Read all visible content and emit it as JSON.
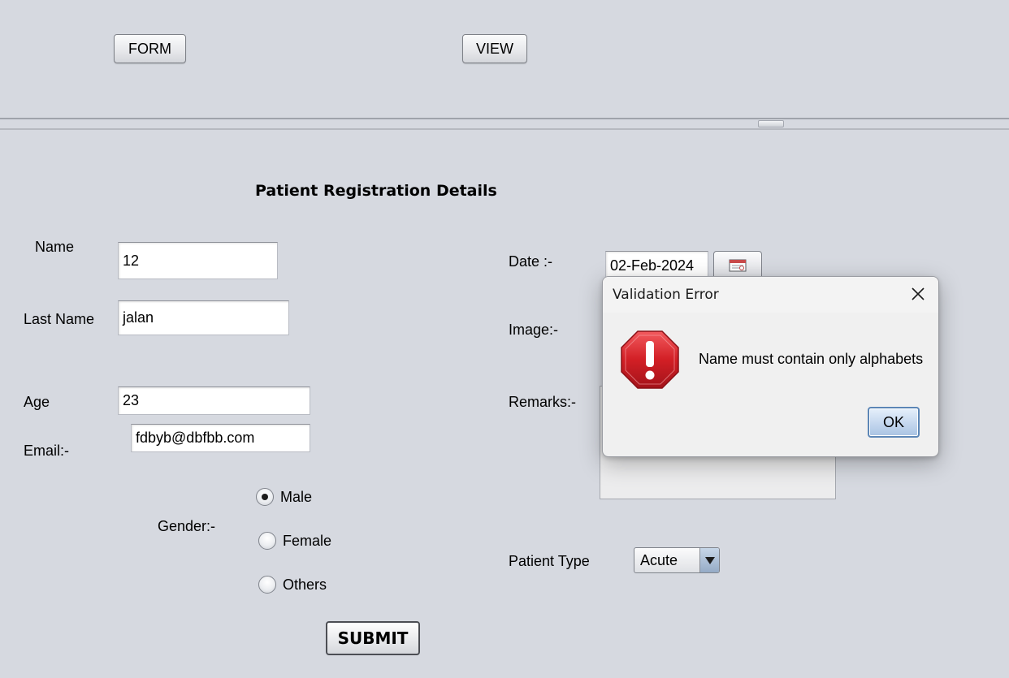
{
  "toolbar": {
    "form_label": "FORM",
    "view_label": "VIEW"
  },
  "form": {
    "title": "Patient Registration Details",
    "name_label": "Name",
    "name_value": "12",
    "last_name_label": "Last Name",
    "last_name_value": "jalan",
    "age_label": "Age",
    "age_value": "23",
    "email_label": "Email:-",
    "email_value": "fdbyb@dbfbb.com",
    "gender_label": "Gender:-",
    "gender_options": [
      "Male",
      "Female",
      "Others"
    ],
    "gender_selected": "Male",
    "date_label": "Date :-",
    "date_value": "02-Feb-2024",
    "image_label": "Image:-",
    "remarks_label": "Remarks:-",
    "patient_type_label": "Patient Type",
    "patient_type_value": "Acute",
    "submit_label": "SUBMIT"
  },
  "dialog": {
    "title": "Validation Error",
    "message": "Name must contain only alphabets",
    "ok_label": "OK",
    "icon": "error-stop-icon",
    "accent_color": "#d21f25"
  },
  "colors": {
    "background": "#d6d9e0",
    "dialog_background": "#f0f0f0",
    "ok_button": "#c4d7ee"
  }
}
